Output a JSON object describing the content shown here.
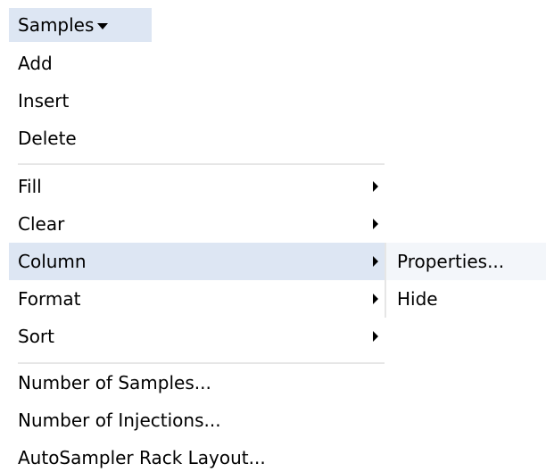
{
  "trigger": {
    "label": "Samples"
  },
  "menu": {
    "items": [
      {
        "label": "Add"
      },
      {
        "label": "Insert"
      },
      {
        "label": "Delete"
      },
      {
        "label": "Fill"
      },
      {
        "label": "Clear"
      },
      {
        "label": "Column"
      },
      {
        "label": "Format"
      },
      {
        "label": "Sort"
      },
      {
        "label": "Number of Samples..."
      },
      {
        "label": "Number of Injections..."
      },
      {
        "label": "AutoSampler Rack Layout..."
      }
    ]
  },
  "submenu": {
    "items": [
      {
        "label": "Properties..."
      },
      {
        "label": "Hide"
      }
    ]
  },
  "colors": {
    "highlight": "#dde6f3",
    "separator": "#e6e6e6"
  },
  "icons": {
    "trigger_caret": "caret-down-icon",
    "submenu_arrow": "chevron-right-icon"
  }
}
